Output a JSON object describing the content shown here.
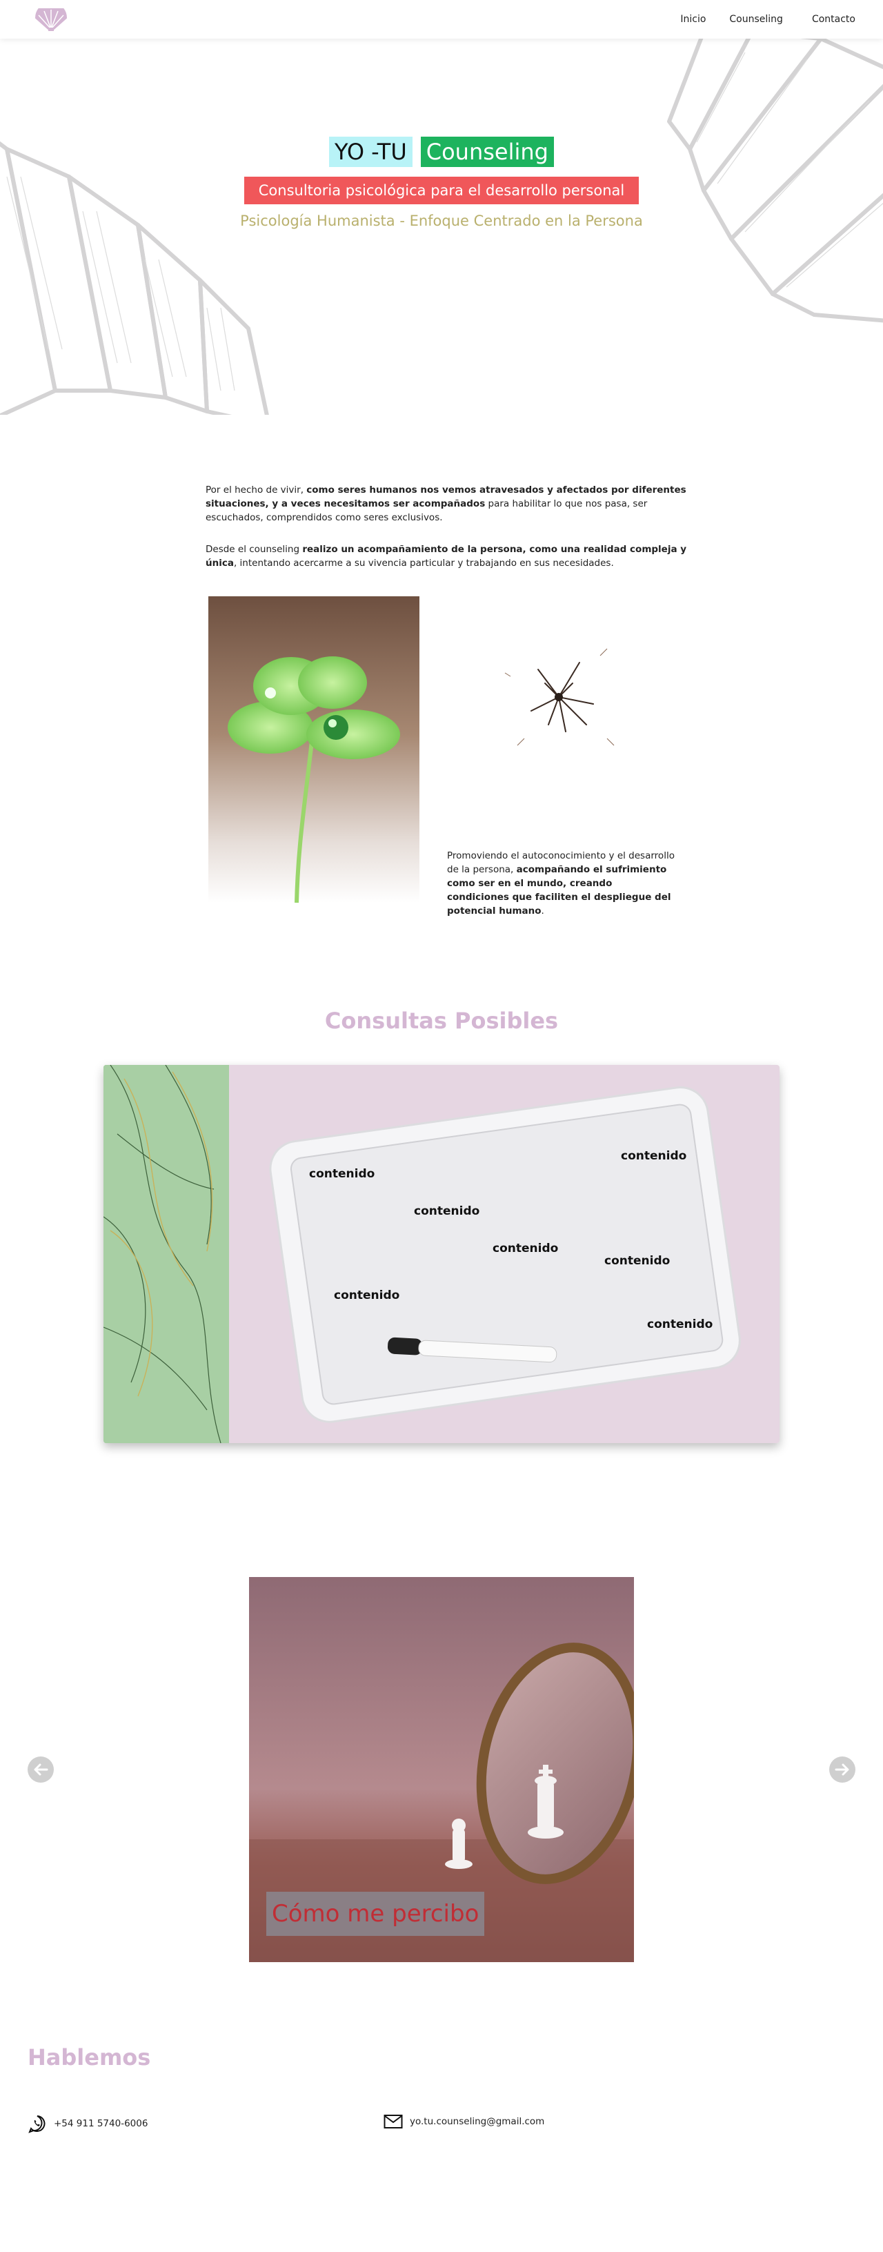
{
  "header": {
    "logo": "fan-logo",
    "nav": [
      {
        "label": "Inicio"
      },
      {
        "label": "Counseling"
      },
      {
        "label": "Contacto"
      }
    ]
  },
  "hero": {
    "title_part1": "YO -TU",
    "title_part2": "Counseling",
    "subtitle": "Consultoria psicológica para el desarrollo personal",
    "tagline": "Psicología Humanista - Enfoque Centrado en la Persona",
    "colors": {
      "title1_bg": "#b8f3f7",
      "title2_bg": "#1db35e",
      "subtitle_bg": "#f0575a",
      "tagline": "#b9b06d"
    }
  },
  "intro": {
    "p1_a": "Por el hecho de vivir, ",
    "p1_b": "como seres humanos nos vemos atravesados y afectados por diferentes situaciones, y a veces necesitamos ser acompañados",
    "p1_c": " para habilitar lo que nos pasa, ser escuchados, comprendidos como seres exclusivos.",
    "p2_a": "Desde el counseling ",
    "p2_b": "realizo un acompañamiento de la persona, como una realidad compleja y única",
    "p2_c": ", intentando acercarme a su vivencia particular y trabajando en sus necesidades."
  },
  "promo": {
    "a": "Promoviendo el autoconocimiento y el desarrollo de la persona, ",
    "b": "acompañando el sufrimiento como ser en el mundo, creando condiciones que faciliten el despliegue del potencial humano",
    "c": "."
  },
  "consultas": {
    "title": "Consultas Posibles",
    "items": [
      "contenido",
      "contenido",
      "contenido",
      "contenido",
      "contenido",
      "contenido",
      "contenido"
    ],
    "title_color": "#d4b6d3"
  },
  "carousel": {
    "caption": "Cómo me percibo",
    "prev_icon": "arrow-left-icon",
    "next_icon": "arrow-right-icon"
  },
  "contact": {
    "title": "Hablemos",
    "phone": "+54 911 5740-6006",
    "email": "yo.tu.counseling@gmail.com",
    "phone_icon": "whatsapp-icon",
    "email_icon": "mail-icon"
  }
}
